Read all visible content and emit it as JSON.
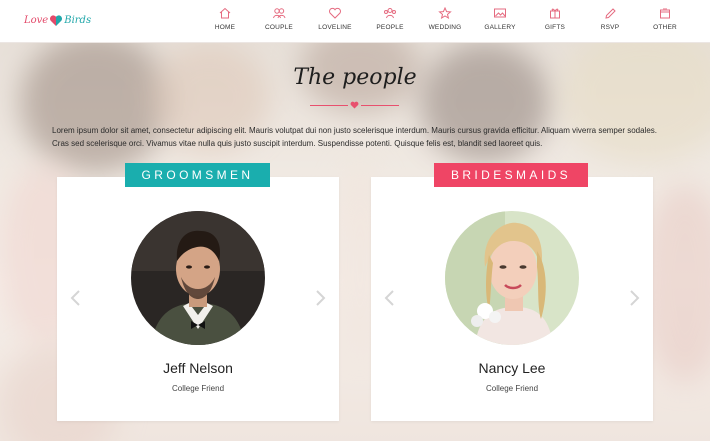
{
  "brand": {
    "word1": "Love",
    "word2": "Birds",
    "accent_pink": "#e34a6a",
    "accent_teal": "#21a7aa"
  },
  "nav": {
    "items": [
      {
        "label": "HOME",
        "icon": "home-icon"
      },
      {
        "label": "COUPLE",
        "icon": "couple-icon"
      },
      {
        "label": "LOVELINE",
        "icon": "heart-icon"
      },
      {
        "label": "PEOPLE",
        "icon": "people-icon"
      },
      {
        "label": "WEDDING",
        "icon": "star-icon"
      },
      {
        "label": "GALLERY",
        "icon": "image-icon"
      },
      {
        "label": "GIFTS",
        "icon": "gift-icon"
      },
      {
        "label": "RSVP",
        "icon": "pencil-icon"
      },
      {
        "label": "OTHER",
        "icon": "box-icon"
      }
    ]
  },
  "section": {
    "title": "The people",
    "intro": "Lorem ipsum dolor sit amet, consectetur adipiscing elit. Mauris volutpat dui non justo scelerisque interdum. Mauris cursus gravida efficitur. Aliquam viverra semper sodales. Cras sed scelerisque orci. Vivamus vitae nulla quis justo suscipit interdum. Suspendisse potenti. Quisque felis est, blandit sed laoreet quis."
  },
  "groomsmen": {
    "heading": "GROOMSMEN",
    "color": "#1aaeae",
    "person": {
      "name": "Jeff Nelson",
      "role": "College Friend"
    }
  },
  "bridesmaids": {
    "heading": "BRIDESMAIDS",
    "color": "#ef4565",
    "person": {
      "name": "Nancy Lee",
      "role": "College Friend"
    }
  }
}
